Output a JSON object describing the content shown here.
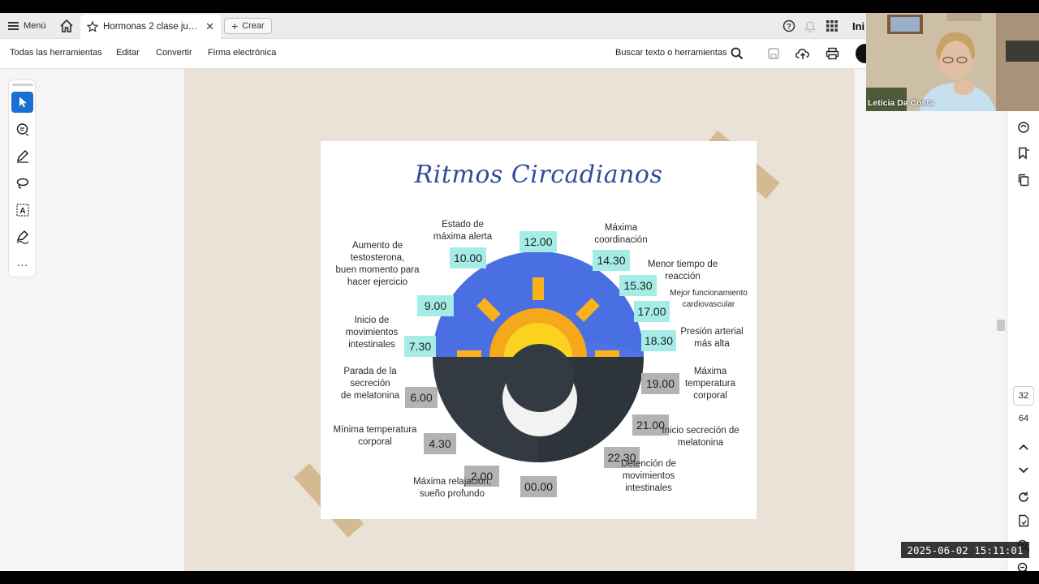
{
  "tabbar": {
    "menu_label": "Menú",
    "tab_title": "Hormonas 2 clase juni...",
    "create_label": "Crear",
    "signin_label": "Ini"
  },
  "toolbar": {
    "items": [
      "Todas las herramientas",
      "Editar",
      "Convertir",
      "Firma electrónica"
    ],
    "search_label": "Buscar texto o herramientas"
  },
  "slide": {
    "title": "Ritmos Circadianos",
    "times": [
      "12.00",
      "10.00",
      "9.00",
      "7.30",
      "6.00",
      "4.30",
      "2.00",
      "00.00",
      "22.30",
      "21.00",
      "19.00",
      "18.30",
      "17.00",
      "15.30",
      "14.30"
    ],
    "labels": {
      "alerta": [
        "Estado de",
        "máxima alerta"
      ],
      "testosterona": [
        "Aumento de",
        "testosterona,",
        "buen momento para",
        "hacer ejercicio"
      ],
      "intestinales_inicio": [
        "Inicio de",
        "movimientos",
        "intestinales"
      ],
      "melatonina_parada": [
        "Parada de la",
        "secreción",
        "de melatonina"
      ],
      "min_temp": [
        "Mínima temperatura",
        "corporal"
      ],
      "relajacion": [
        "Máxima relajación,",
        "sueño profundo"
      ],
      "intestinales_det": [
        "Detención de",
        "movimientos",
        "intestinales"
      ],
      "melatonina_inicio": [
        "Inicio secreción de",
        "melatonina"
      ],
      "max_temp": [
        "Máxima",
        "temperatura",
        "corporal"
      ],
      "presion": [
        "Presión arterial",
        "más alta"
      ],
      "cardio": [
        "Mejor funcionamiento",
        "cardiovascular"
      ],
      "reaccion": [
        "Menor tiempo de",
        "reacción"
      ],
      "coordinacion": [
        "Máxima",
        "coordinación"
      ]
    }
  },
  "right_rail": {
    "page_current": "32",
    "page_total": "64"
  },
  "webcam": {
    "name": "Leticia Da Costa"
  },
  "timestamp": "2025-06-02  15:11:01",
  "colors": {
    "accent": "#1b6fd1",
    "day_box": "#a6ece6",
    "night_box": "#b3b3b3",
    "sky": "#4a6fe3",
    "night": "#343a42",
    "sun": "#f9b21b"
  }
}
